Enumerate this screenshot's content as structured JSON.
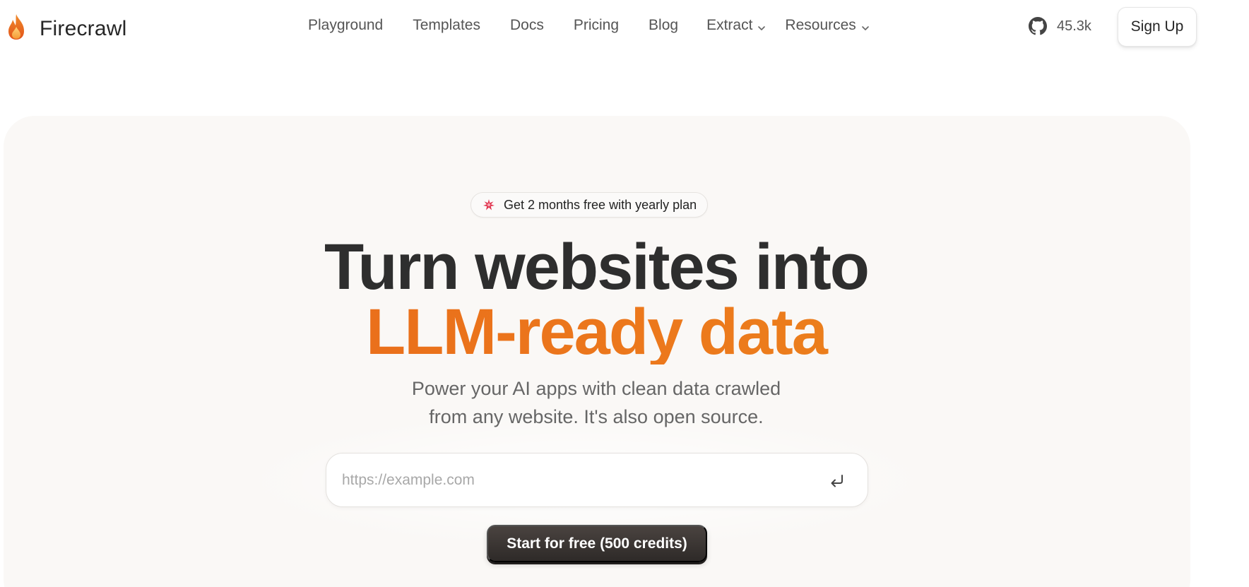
{
  "nav": {
    "brand": "Firecrawl",
    "links": [
      {
        "label": "Playground"
      },
      {
        "label": "Templates"
      },
      {
        "label": "Docs"
      },
      {
        "label": "Pricing"
      },
      {
        "label": "Blog"
      }
    ],
    "dropdowns": [
      {
        "label": "Extract"
      },
      {
        "label": "Resources"
      }
    ],
    "github_stars": "45.3k",
    "signup_label": "Sign Up"
  },
  "hero": {
    "promo": "Get 2 months free with yearly plan",
    "headline_line1": "Turn websites into",
    "headline_line2": "LLM-ready data",
    "subtitle_line1": "Power your AI apps with clean data crawled",
    "subtitle_line2": "from any website. It's also open source.",
    "url_placeholder": "https://example.com",
    "cta_label": "Start for free (500 credits)"
  },
  "colors": {
    "accent": "#e8701a",
    "cta_bg": "#3a3431",
    "hero_bg": "#faf8f6"
  },
  "icons": {
    "logo": "flame-icon",
    "github": "github-icon",
    "promo": "sparkle-icon",
    "enter": "enter-icon",
    "dropdown": "chevron-down-icon"
  }
}
